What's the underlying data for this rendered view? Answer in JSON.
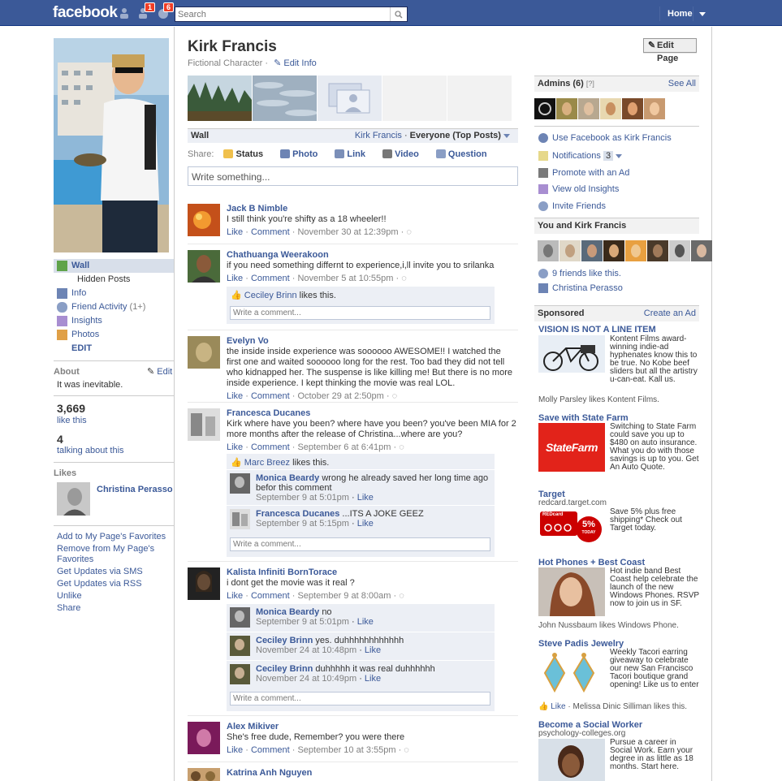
{
  "header": {
    "logo": "facebook",
    "friend_req_count": "1",
    "notif_count": "6",
    "search_placeholder": "Search",
    "home": "Home"
  },
  "colors": {
    "brand": "#3b5998",
    "badge": "#f03d25",
    "link": "#3b5998"
  },
  "left": {
    "nav": [
      {
        "label": "Wall",
        "icon": "wall-icon"
      },
      {
        "label": "Hidden Posts",
        "icon": ""
      },
      {
        "label": "Info",
        "icon": "info-icon"
      },
      {
        "label": "Friend Activity",
        "count": "(1+)",
        "icon": "friends-icon"
      },
      {
        "label": "Insights",
        "icon": "insights-icon"
      },
      {
        "label": "Photos",
        "icon": "photos-icon"
      }
    ],
    "edit": "EDIT",
    "about_title": "About",
    "about_edit": "Edit",
    "about_text": "It was inevitable.",
    "likes_count": "3,669",
    "likes_label": "like this",
    "talking_count": "4",
    "talking_label": "talking about this",
    "likes_title": "Likes",
    "liked_page": "Christina Perasso",
    "actions": [
      "Add to My Page's Favorites",
      "Remove from My Page's Favorites",
      "Get Updates via SMS",
      "Get Updates via RSS",
      "Unlike",
      "Share"
    ]
  },
  "main": {
    "name": "Kirk Francis",
    "category": "Fictional Character",
    "dot": "·",
    "edit_info": "Edit Info",
    "edit_page": "Edit Page",
    "wall_title": "Wall",
    "wall_filter_name": "Kirk Francis",
    "wall_filter": "Everyone (Top Posts)",
    "share_label": "Share:",
    "share_items": [
      "Status",
      "Photo",
      "Link",
      "Video",
      "Question"
    ],
    "status_placeholder": "Write something...",
    "like": "Like",
    "comment": "Comment",
    "write_comment": "Write a comment...",
    "likes_this": "likes this.",
    "posts": [
      {
        "author": "Jack B Nimble",
        "text": "I still think you're shifty as a 18 wheeler!!",
        "time": "November 30 at 12:39pm"
      },
      {
        "author": "Chathuanga Weerakoon",
        "text": "if you need something differnt to experience,i,ll invite you to srilanka",
        "time": "November 5 at 10:55pm",
        "liker": "Ceciley Brinn"
      },
      {
        "author": "Evelyn Vo",
        "text": "the inside inside experience was soooooo AWESOME!! I watched the first one and waited soooooo long for the rest. Too bad they did not tell who kidnapped her. The suspense is like killing me! But there is no more inside experience. I kept thinking the movie was real LOL.",
        "time": "October 29 at 2:50pm"
      },
      {
        "author": "Francesca Ducanes",
        "text": "Kirk where have you been? where have you been? you've been MIA for 2 more months after the release of Christina...where are you?",
        "time": "September 6 at 6:41pm",
        "liker": "Marc Breez",
        "comments": [
          {
            "author": "Monica Beardy",
            "text": "wrong he already saved her long time ago befor this comment",
            "time": "September 9 at 5:01pm"
          },
          {
            "author": "Francesca Ducanes",
            "text": "...ITS A JOKE GEEZ",
            "time": "September 9 at 5:15pm"
          }
        ]
      },
      {
        "author": "Kalista Infiniti BornTorace",
        "text": "i dont get the movie was it real ?",
        "time": "September 9 at 8:00am",
        "comments": [
          {
            "author": "Monica Beardy",
            "text": "no",
            "time": "September 9 at 5:01pm"
          },
          {
            "author": "Ceciley Brinn",
            "text": "yes. duhhhhhhhhhhhh",
            "time": "November 24 at 10:48pm"
          },
          {
            "author": "Ceciley Brinn",
            "text": "duhhhhh it was real duhhhhhh",
            "time": "November 24 at 10:49pm"
          }
        ]
      },
      {
        "author": "Alex Mikiver",
        "text": "She's free dude, Remember? you were there",
        "time": "September 10 at 3:55pm"
      },
      {
        "author": "Katrina Anh Nguyen"
      }
    ]
  },
  "right": {
    "admins_title": "Admins (6)",
    "admins_help": "[?]",
    "see_all": "See All",
    "admin_links": [
      "Use Facebook as Kirk Francis",
      "Notifications",
      "Promote with an Ad",
      "View old Insights",
      "Invite Friends"
    ],
    "notif_count": "3",
    "you_and": "You and Kirk Francis",
    "friends_like": "9 friends like this.",
    "friend_name": "Christina Perasso",
    "sponsored": "Sponsored",
    "create_ad": "Create an Ad",
    "ads": [
      {
        "title": "VISION IS NOT A LINE ITEM",
        "text": "Kontent Films award-winning indie-ad hyphenates know this to be true. No Kobe beef sliders but all the artistry u-can-eat. Kall us.",
        "social": "Molly Parsley likes Kontent Films."
      },
      {
        "title": "Save with State Farm",
        "text": "Switching to State Farm could save you up to $480 on auto insurance. What you do with those savings is up to you. Get An Auto Quote.",
        "logo": "StateFarm"
      },
      {
        "title": "Target",
        "domain": "redcard.target.com",
        "text": "Save 5% plus free shipping* Check out Target today.",
        "img_top": "REDcard",
        "img_pct": "5%",
        "img_sub": "TODAY"
      },
      {
        "title": "Hot Phones + Best Coast",
        "text": "Hot indie band Best Coast help celebrate the launch of the new Windows Phones. RSVP now to join us in SF.",
        "social": "John Nussbaum likes Windows Phone."
      },
      {
        "title": "Steve Padis Jewelry",
        "text": "Weekly Tacori earring giveaway to celebrate our new San Francisco Tacori boutique grand opening! Like us to enter",
        "like": "Like",
        "social": "· Melissa Dinic Silliman likes this."
      },
      {
        "title": "Become a Social Worker",
        "domain": "psychology-colleges.org",
        "text": "Pursue a career in Social Work. Earn your degree in as little as 18 months. Start here."
      }
    ]
  }
}
